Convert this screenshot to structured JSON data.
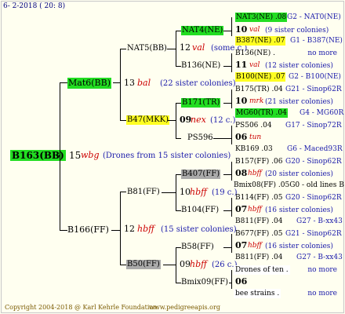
{
  "date": "6- 2-2018 ( 20: 8)",
  "copyright": "Copyright 2004-2018 @ Karl Kehrle Foundation.",
  "website": "www.pedigreeapis.org",
  "root": {
    "code": "B163(BB)",
    "num": "15",
    "mark": "wbg",
    "info": "(Drones from 15 sister colonies)"
  },
  "l1": [
    {
      "code": "Mat6(BB)",
      "num": "13",
      "mark": "bal",
      "info": "(22 sister colonies)"
    },
    {
      "code": "B166(FF)",
      "num": "12",
      "mark": "hbff",
      "info": "(15 sister colonies)"
    }
  ],
  "l2": [
    {
      "code": "NAT5(BB)",
      "num": "12",
      "mark": "val",
      "info": "(some c.)"
    },
    {
      "code": "B47(MKK)",
      "num": "09",
      "mark": "nex",
      "info": "(12 c.)"
    },
    {
      "code": "B81(FF)",
      "num": "10",
      "mark": "hbff",
      "info": "(19 c.)"
    },
    {
      "code": "B50(FF)",
      "num": "09",
      "mark": "hbff",
      "info": "(26 c.)"
    }
  ],
  "l3": [
    {
      "code": "NAT4(NE)"
    },
    {
      "code": "B136(NE)"
    },
    {
      "code": "B171(TR)"
    },
    {
      "code": "PS596"
    },
    {
      "code": "B407(FF)"
    },
    {
      "code": "B104(FF)"
    },
    {
      "code": "B58(FF)"
    },
    {
      "code": "Bmix09(FF)"
    }
  ],
  "l4": [
    {
      "top": "NAT3(NE) .08",
      "topr": "G2 - NAT0(NE)",
      "num": "10",
      "mark": "val",
      "info": "(9 sister colonies)",
      "bot": "B387(NE) .07",
      "botr": "G1 - B387(NE)"
    },
    {
      "top": "B136(NE) .",
      "topr": "no more",
      "num": "11",
      "mark": "val",
      "info": "(12 sister colonies)",
      "bot": "B100(NE) .07",
      "botr": "G2 - B100(NE)"
    },
    {
      "top": "B175(TR) .04",
      "topr": "G21 - Sinop62R",
      "num": "10",
      "mark": "mrk",
      "info": "(21 sister colonies)",
      "bot": "MG60(TR) .04",
      "botr": "G4 - MG60R"
    },
    {
      "top": "PS506 .04",
      "topr": "G17 - Sinop72R",
      "num": "06",
      "mark": "tun",
      "info": "",
      "bot": "KB169 .03",
      "botr": "G6 - Maced93R"
    },
    {
      "top": "B157(FF) .06",
      "topr": "G20 - Sinop62R",
      "num": "08",
      "mark": "hbff",
      "info": "(20 sister colonies)",
      "bot": "Bmix08(FF) .05G0 - old lines B",
      "botr": ""
    },
    {
      "top": "B114(FF) .05",
      "topr": "G20 - Sinop62R",
      "num": "07",
      "mark": "hbff",
      "info": "(16 sister colonies)",
      "bot": "B811(FF) .04",
      "botr": "G27 - B-xx43"
    },
    {
      "top": "B677(FF) .05",
      "topr": "G21 - Sinop62R",
      "num": "07",
      "mark": "hbff",
      "info": "(16 sister colonies)",
      "bot": "B811(FF) .04",
      "botr": "G27 - B-xx43"
    },
    {
      "top": "Drones of ten .",
      "topr": "no more",
      "num": "06",
      "mark": "",
      "info": "",
      "bot": "bee strains .",
      "botr": "no more"
    }
  ]
}
